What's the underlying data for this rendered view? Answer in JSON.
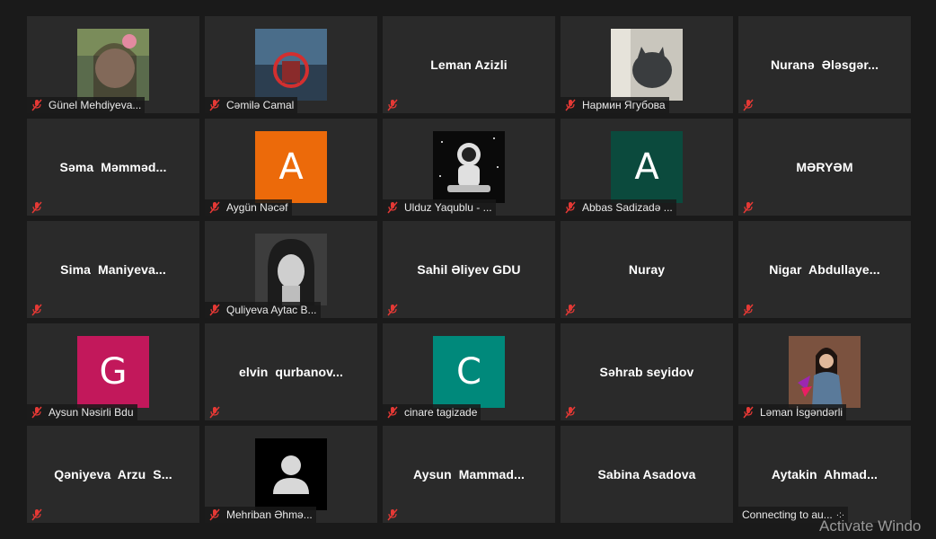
{
  "participants": [
    {
      "label": "Günel Mehdiyeva..."
    },
    {
      "label": "Cəmilə Camal"
    },
    {
      "name": "Leman Azizli"
    },
    {
      "label": "Нармин Ягубова"
    },
    {
      "name": "Nuranə  Ələsgər..."
    },
    {
      "name": "Səma  Məmməd..."
    },
    {
      "label": "Aygün Nəcəf",
      "avatar_letter": "A",
      "avatar_color": "#ec6a0a"
    },
    {
      "label": "Ulduz Yaqublu - ..."
    },
    {
      "label": "Abbas Sadizadə ...",
      "avatar_letter": "A",
      "avatar_color": "#0b4a3d"
    },
    {
      "name": "MƏRYƏM"
    },
    {
      "name": "Sima  Maniyeva..."
    },
    {
      "label": "Quliyeva Aytac B..."
    },
    {
      "name": "Sahil Əliyev GDU"
    },
    {
      "name": "Nuray"
    },
    {
      "name": "Nigar  Abdullaye..."
    },
    {
      "label": "Aysun Nəsirli Bdu",
      "avatar_letter": "G",
      "avatar_color": "#c2185b"
    },
    {
      "name": "elvin  qurbanov..."
    },
    {
      "label": "cinare tagizade",
      "avatar_letter": "C",
      "avatar_color": "#00897b"
    },
    {
      "name": "Səhrab seyidov"
    },
    {
      "label": "Ləman İsgəndərli"
    },
    {
      "name": "Qəniyeva  Arzu  S..."
    },
    {
      "label": "Mehriban Əhmə..."
    },
    {
      "name": "Aysun  Mammad..."
    },
    {
      "name": "Sabina Asadova"
    },
    {
      "name": "Aytakin  Ahmad...",
      "status": "Connecting to au..."
    }
  ],
  "watermark": "Activate Windo",
  "colors": {
    "tile": "#2a2a2a",
    "background": "#1a1a1a",
    "mute_icon": "#e53935"
  }
}
